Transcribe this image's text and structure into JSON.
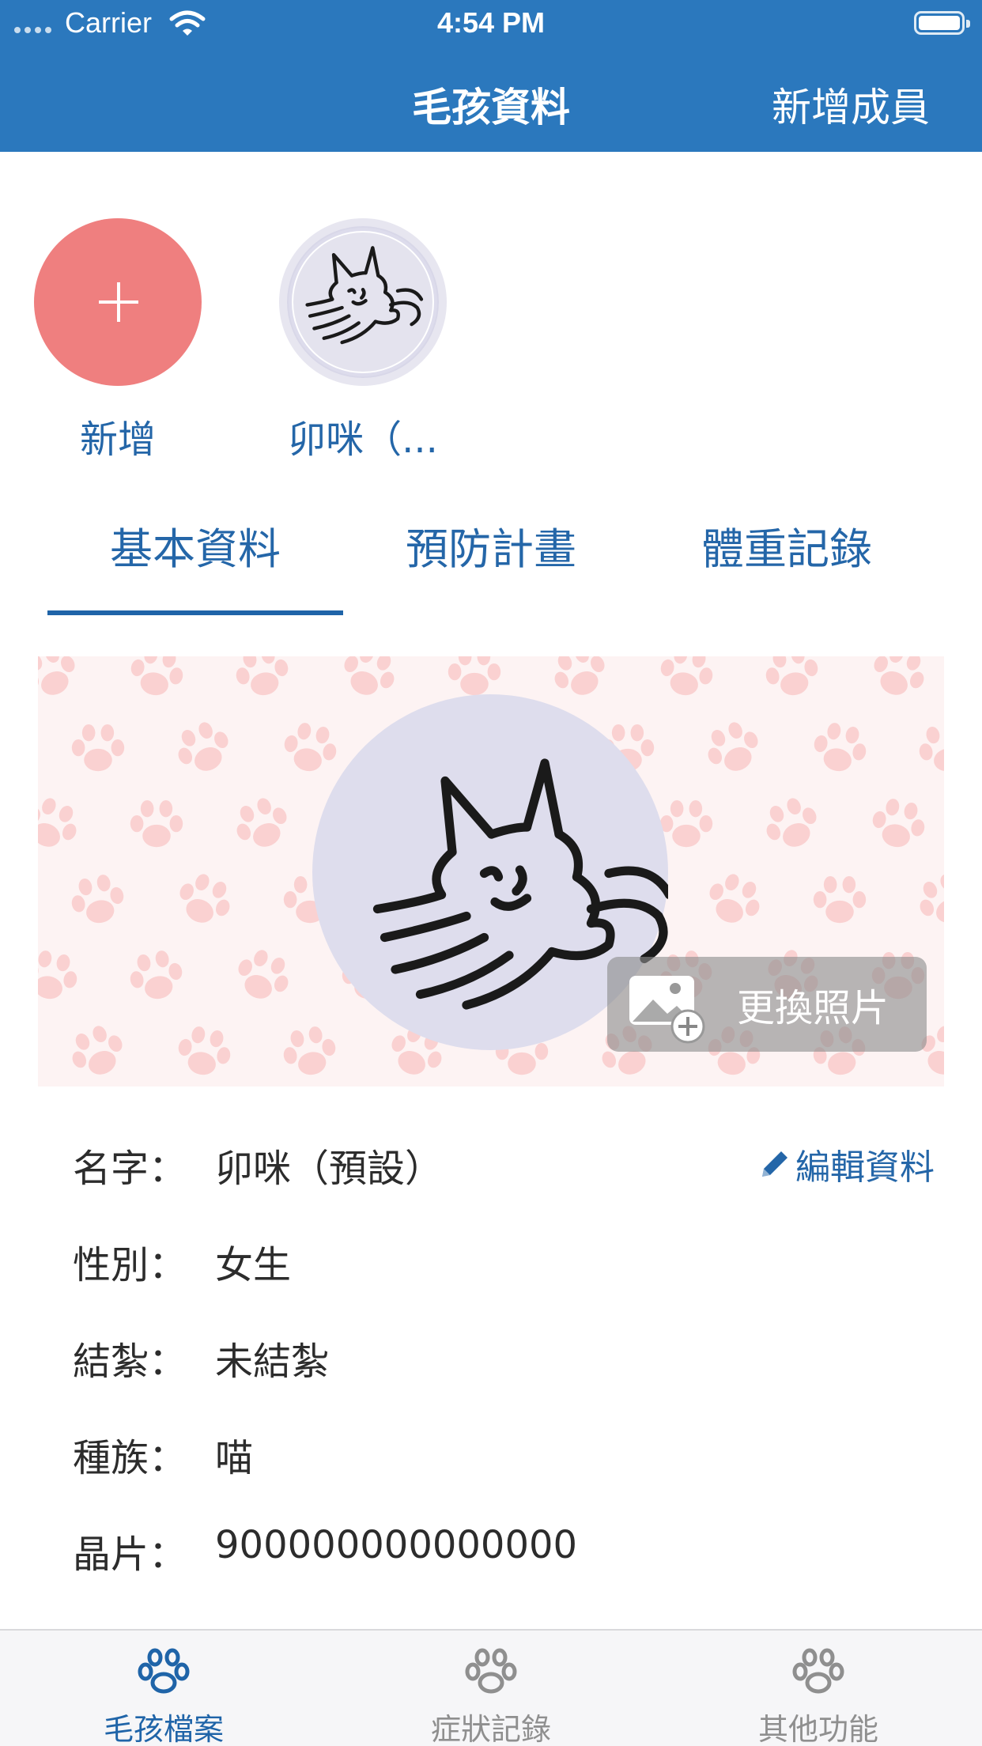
{
  "status_bar": {
    "carrier": "Carrier",
    "time": "4:54 PM"
  },
  "nav": {
    "title": "毛孩資料",
    "right_button": "新增成員"
  },
  "members": [
    {
      "label": "新增"
    },
    {
      "label": "卯咪（..."
    }
  ],
  "tabs": [
    {
      "label": "基本資料",
      "selected": true
    },
    {
      "label": "預防計畫",
      "selected": false
    },
    {
      "label": "體重記錄",
      "selected": false
    }
  ],
  "banner": {
    "change_photo_label": "更換照片"
  },
  "details": {
    "edit_label": "編輯資料",
    "rows": [
      {
        "key": "名字：",
        "value": "卯咪（預設）"
      },
      {
        "key": "性別：",
        "value": "女生"
      },
      {
        "key": "結紮：",
        "value": "未結紮"
      },
      {
        "key": "種族：",
        "value": "喵"
      },
      {
        "key": "晶片：",
        "value": "900000000000000"
      }
    ]
  },
  "tab_bar": [
    {
      "label": "毛孩檔案",
      "icon": "paw-icon",
      "active": true
    },
    {
      "label": "症狀記錄",
      "icon": "paw-icon",
      "active": false
    },
    {
      "label": "其他功能",
      "icon": "paw-icon",
      "active": false
    }
  ],
  "colors": {
    "nav_blue": "#2b78bd",
    "accent_blue": "#2466a8",
    "add_red": "#ef7f7f",
    "inactive_gray": "#8f8f8f"
  }
}
